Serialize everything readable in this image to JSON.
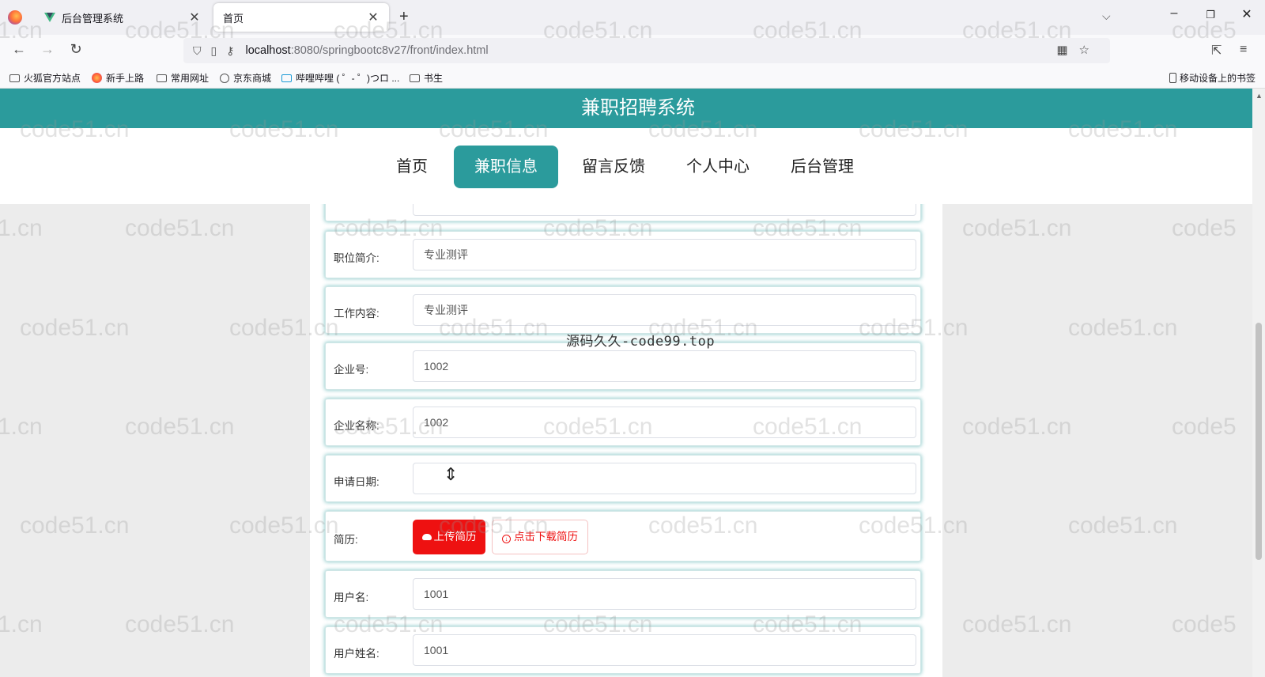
{
  "browser": {
    "tabs": [
      {
        "title": "后台管理系统",
        "close": "✕"
      },
      {
        "title": "首页",
        "close": "✕"
      }
    ],
    "new_tab": "+",
    "url_host": "localhost",
    "url_path": ":8080/springbootc8v27/front/index.html",
    "bookmarks": [
      "火狐官方站点",
      "新手上路",
      "常用网址",
      "京东商城",
      "哔哩哔哩 ( ゜- ゜)つロ ...",
      "书生"
    ],
    "mobile_bookmarks": "移动设备上的书签"
  },
  "site": {
    "title": "兼职招聘系统",
    "menu": [
      "首页",
      "兼职信息",
      "留言反馈",
      "个人中心",
      "后台管理"
    ],
    "active_menu_index": 1
  },
  "form": {
    "rows": [
      {
        "label": "职位简介:",
        "value": "专业测评"
      },
      {
        "label": "工作内容:",
        "value": "专业测评"
      },
      {
        "label": "企业号:",
        "value": "1002"
      },
      {
        "label": "企业名称:",
        "value": "1002"
      },
      {
        "label": "申请日期:",
        "value": ""
      },
      {
        "label": "简历:",
        "upload_label": "上传简历",
        "download_label": "点击下载简历"
      },
      {
        "label": "用户名:",
        "value": "1001"
      },
      {
        "label": "用户姓名:",
        "value": "1001"
      }
    ]
  },
  "overlay_text": "源码久久-code99.top",
  "watermark": "code51.cn",
  "watermark_partial": "1.cn",
  "watermark_partial_right": "code5",
  "colors": {
    "accent": "#2b9b9c",
    "danger": "#ee1111"
  }
}
